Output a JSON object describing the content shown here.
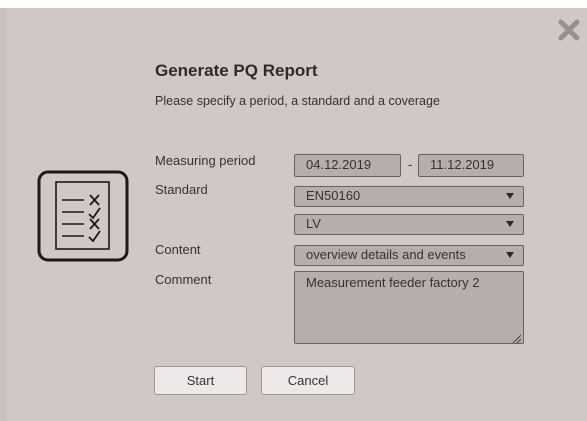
{
  "dialog": {
    "title": "Generate PQ Report",
    "subtitle": "Please specify a period, a standard and a coverage",
    "close_icon": "close-x-icon"
  },
  "form": {
    "measuring_period_label": "Measuring period",
    "period_start": "04.12.2019",
    "period_separator": "-",
    "period_end": "11.12.2019",
    "standard_label": "Standard",
    "standard_value": "EN50160",
    "voltage_value": "LV",
    "content_label": "Content",
    "content_value": "overview details and events",
    "comment_label": "Comment",
    "comment_value": "Measurement feeder factory 2"
  },
  "buttons": {
    "start": "Start",
    "cancel": "Cancel"
  },
  "icons": {
    "report": "checklist-document-icon",
    "dropdown": "dropdown-arrow-icon"
  },
  "colors": {
    "background": "#d1c7c4",
    "field_bg": "#b7adaa",
    "button_bg": "#ede9e8"
  }
}
